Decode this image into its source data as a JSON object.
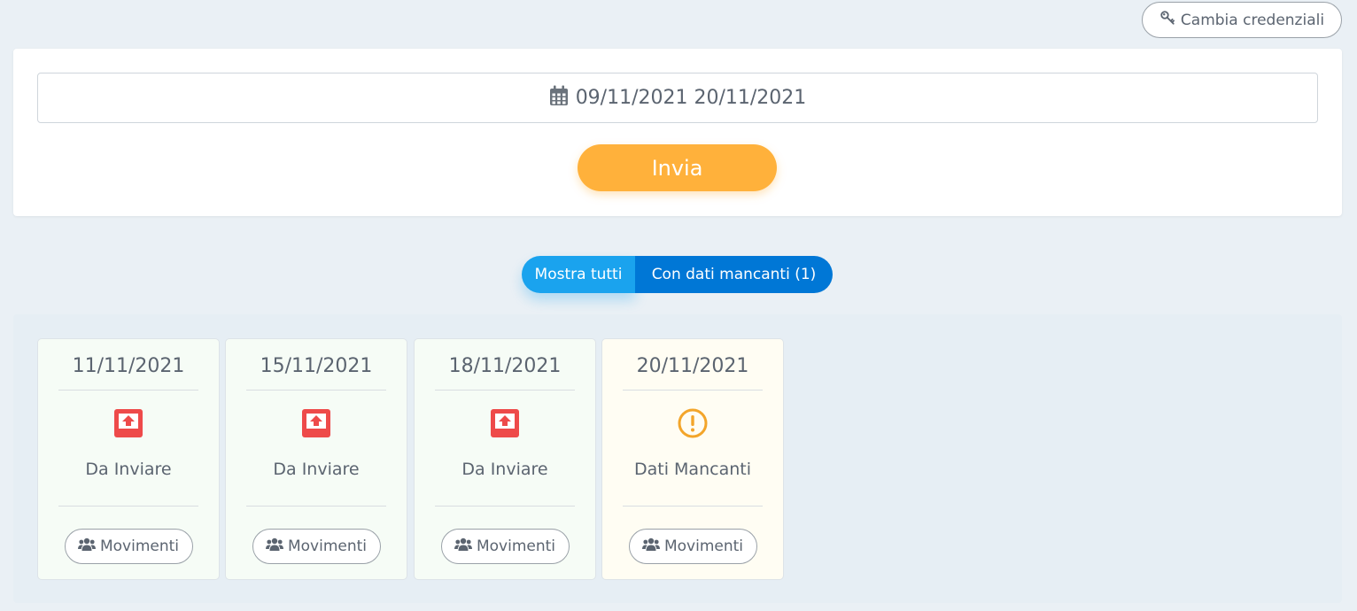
{
  "header": {
    "credentials_label": "Cambia credenziali",
    "credentials_icon": "key-icon"
  },
  "form": {
    "date_range_value": "09/11/2021 20/11/2021",
    "date_icon": "calendar-icon",
    "submit_label": "Invia"
  },
  "filters": {
    "all_label": "Mostra tutti",
    "missing_label": "Con dati mancanti (1)",
    "active": "Mostra tutti"
  },
  "days": [
    {
      "date": "11/11/2021",
      "status": "Da Inviare",
      "status_icon": "upload-tray-icon",
      "action": "Movimenti"
    },
    {
      "date": "15/11/2021",
      "status": "Da Inviare",
      "status_icon": "upload-tray-icon",
      "action": "Movimenti"
    },
    {
      "date": "18/11/2021",
      "status": "Da Inviare",
      "status_icon": "upload-tray-icon",
      "action": "Movimenti"
    },
    {
      "date": "20/11/2021",
      "status": "Dati Mancanti",
      "status_icon": "warning-circle-icon",
      "action": "Movimenti"
    }
  ],
  "colors": {
    "accent_orange": "#ffb13b",
    "toggle_blue_light": "#1aa3ee",
    "toggle_blue_dark": "#0077d6",
    "status_red": "#ee4a4a",
    "status_warning": "#f3a52a",
    "card_green_bg": "#f6fcf6",
    "card_yellow_bg": "#fffdf3"
  }
}
